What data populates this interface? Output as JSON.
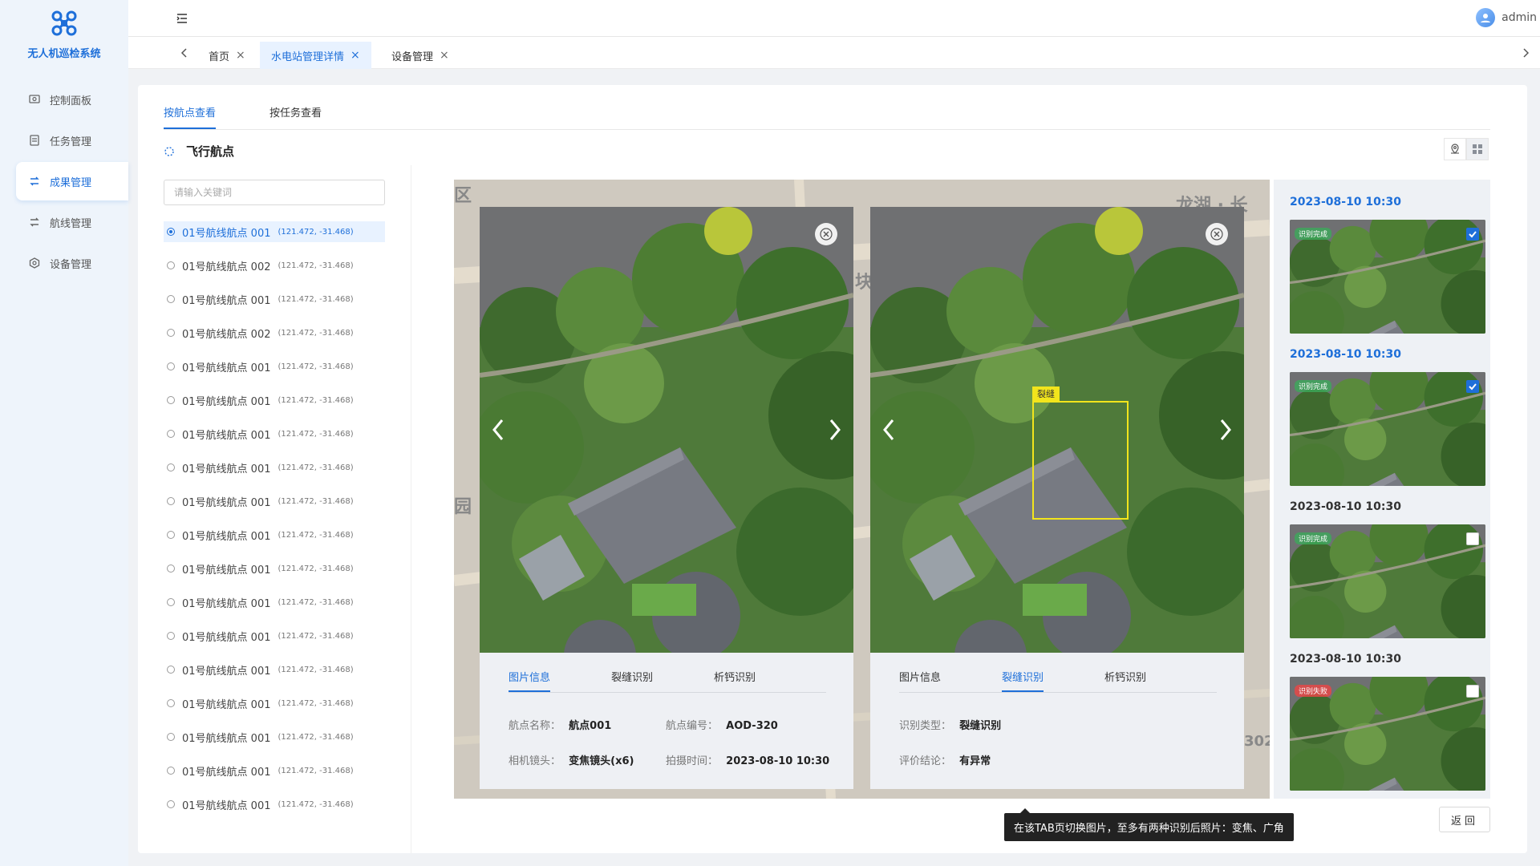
{
  "app": {
    "title": "无人机巡检系统"
  },
  "sidebar": {
    "items": [
      {
        "label": "控制面板",
        "icon": "dashboard-icon"
      },
      {
        "label": "任务管理",
        "icon": "task-icon"
      },
      {
        "label": "成果管理",
        "icon": "results-icon",
        "active": true
      },
      {
        "label": "航线管理",
        "icon": "route-icon"
      },
      {
        "label": "设备管理",
        "icon": "device-icon"
      }
    ]
  },
  "header": {
    "user": "admin"
  },
  "tabs": [
    {
      "label": "首页"
    },
    {
      "label": "水电站管理详情",
      "active": true
    },
    {
      "label": "设备管理"
    }
  ],
  "subtabs": [
    {
      "label": "按航点查看",
      "active": true
    },
    {
      "label": "按任务查看"
    }
  ],
  "panel": {
    "title": "飞行航点",
    "search_placeholder": "请输入关键词"
  },
  "waypoints": [
    {
      "name": "01号航线航点 001",
      "coord": "(121.472, -31.468)"
    },
    {
      "name": "01号航线航点 002",
      "coord": "(121.472, -31.468)"
    },
    {
      "name": "01号航线航点 001",
      "coord": "(121.472, -31.468)"
    },
    {
      "name": "01号航线航点 002",
      "coord": "(121.472, -31.468)"
    },
    {
      "name": "01号航线航点 001",
      "coord": "(121.472, -31.468)"
    },
    {
      "name": "01号航线航点 001",
      "coord": "(121.472, -31.468)"
    },
    {
      "name": "01号航线航点 001",
      "coord": "(121.472, -31.468)"
    },
    {
      "name": "01号航线航点 001",
      "coord": "(121.472, -31.468)"
    },
    {
      "name": "01号航线航点 001",
      "coord": "(121.472, -31.468)"
    },
    {
      "name": "01号航线航点 001",
      "coord": "(121.472, -31.468)"
    },
    {
      "name": "01号航线航点 001",
      "coord": "(121.472, -31.468)"
    },
    {
      "name": "01号航线航点 001",
      "coord": "(121.472, -31.468)"
    },
    {
      "name": "01号航线航点 001",
      "coord": "(121.472, -31.468)"
    },
    {
      "name": "01号航线航点 001",
      "coord": "(121.472, -31.468)"
    },
    {
      "name": "01号航线航点 001",
      "coord": "(121.472, -31.468)"
    },
    {
      "name": "01号航线航点 001",
      "coord": "(121.472, -31.468)"
    },
    {
      "name": "01号航线航点 001",
      "coord": "(121.472, -31.468)"
    },
    {
      "name": "01号航线航点 001",
      "coord": "(121.472, -31.468)"
    }
  ],
  "map": {
    "labels": [
      "龙湖 · 长",
      "块",
      "园",
      "区",
      "302"
    ]
  },
  "photo1": {
    "tabs": [
      "图片信息",
      "裂缝识别",
      "析钙识别"
    ],
    "fields": [
      {
        "label": "航点名称：",
        "value": "航点001"
      },
      {
        "label": "航点编号：",
        "value": "AOD-320"
      },
      {
        "label": "相机镜头：",
        "value": "变焦镜头(x6)"
      },
      {
        "label": "拍摄时间：",
        "value": "2023-08-10 10:30"
      }
    ]
  },
  "photo2": {
    "tabs": [
      "图片信息",
      "裂缝识别",
      "析钙识别"
    ],
    "defect_label": "裂缝",
    "fields": [
      {
        "label": "识别类型：",
        "value": "裂缝识别"
      },
      {
        "label": "评价结论：",
        "value": "有异常"
      }
    ]
  },
  "thumbnails": [
    {
      "time": "2023-08-10 10:30",
      "status": "识别完成",
      "checked": true
    },
    {
      "time": "2023-08-10 10:30",
      "status": "识别完成",
      "checked": true
    },
    {
      "time": "2023-08-10 10:30",
      "status": "识别完成",
      "checked": false
    },
    {
      "time": "2023-08-10 10:30",
      "status": "识别失败",
      "checked": false
    }
  ],
  "tooltip": "在该TAB页切换图片，至多有两种识别后照片：变焦、广角",
  "back_button": "返回"
}
